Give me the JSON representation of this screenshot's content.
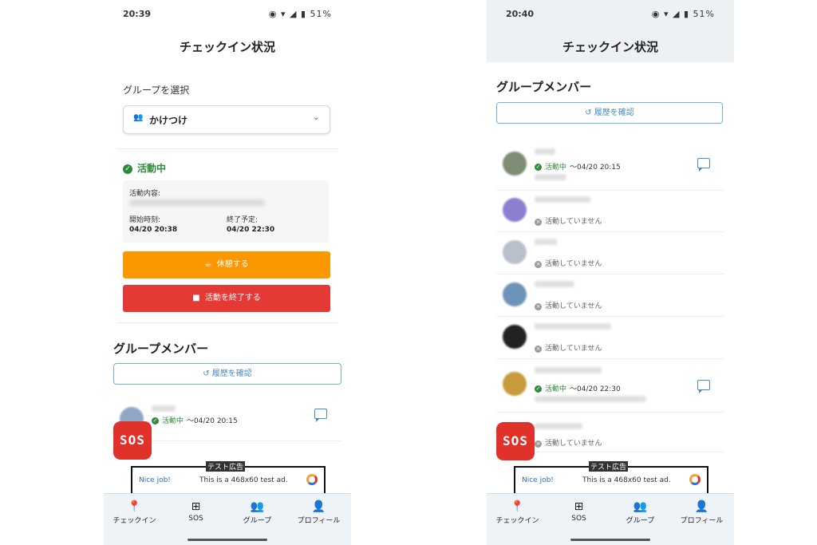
{
  "left": {
    "status": {
      "time": "20:39",
      "right": "◉ ▾ ◢ ▮ 51%"
    },
    "title": "チェックイン状況",
    "group_select_label": "グループを選択",
    "group_value": "かけつけ",
    "active_status": "活動中",
    "info": {
      "content_label": "活動内容:",
      "start_label": "開始時刻:",
      "start_value": "04/20 20:38",
      "end_label": "終了予定:",
      "end_value": "04/20 22:30"
    },
    "break_button": "休憩する",
    "end_button": "活動を終了する",
    "members_title": "グループメンバー",
    "history_button": "履歴を確認",
    "members": [
      {
        "status": "活動中",
        "time": "〜04/20 20:15"
      }
    ]
  },
  "right": {
    "status": {
      "time": "20:40",
      "right": "◉ ▾ ◢ ▮ 51%"
    },
    "title": "チェックイン状況",
    "members_title": "グループメンバー",
    "history_button": "履歴を確認",
    "members": [
      {
        "status": "活動中",
        "time": "〜04/20 20:15",
        "active": true
      },
      {
        "status": "活動していません",
        "active": false
      },
      {
        "status": "活動していません",
        "active": false
      },
      {
        "status": "活動していません",
        "active": false
      },
      {
        "status": "活動していません",
        "active": false
      },
      {
        "status": "活動中",
        "time": "〜04/20 22:30",
        "active": true
      },
      {
        "status": "活動していません",
        "active": false
      }
    ]
  },
  "sos_label": "SOS",
  "ad": {
    "tag": "テスト広告",
    "nice": "Nice job!",
    "text": "This is a 468x60 test ad."
  },
  "nav": [
    {
      "label": "チェックイン",
      "icon": "location-pin-icon"
    },
    {
      "label": "SOS",
      "icon": "plus-box-icon"
    },
    {
      "label": "グループ",
      "icon": "group-icon"
    },
    {
      "label": "プロフィール",
      "icon": "person-icon"
    }
  ],
  "colors": {
    "orange": "#fb9800",
    "red": "#e53935",
    "green": "#2e8b3a",
    "accent": "#4a8bb8"
  }
}
